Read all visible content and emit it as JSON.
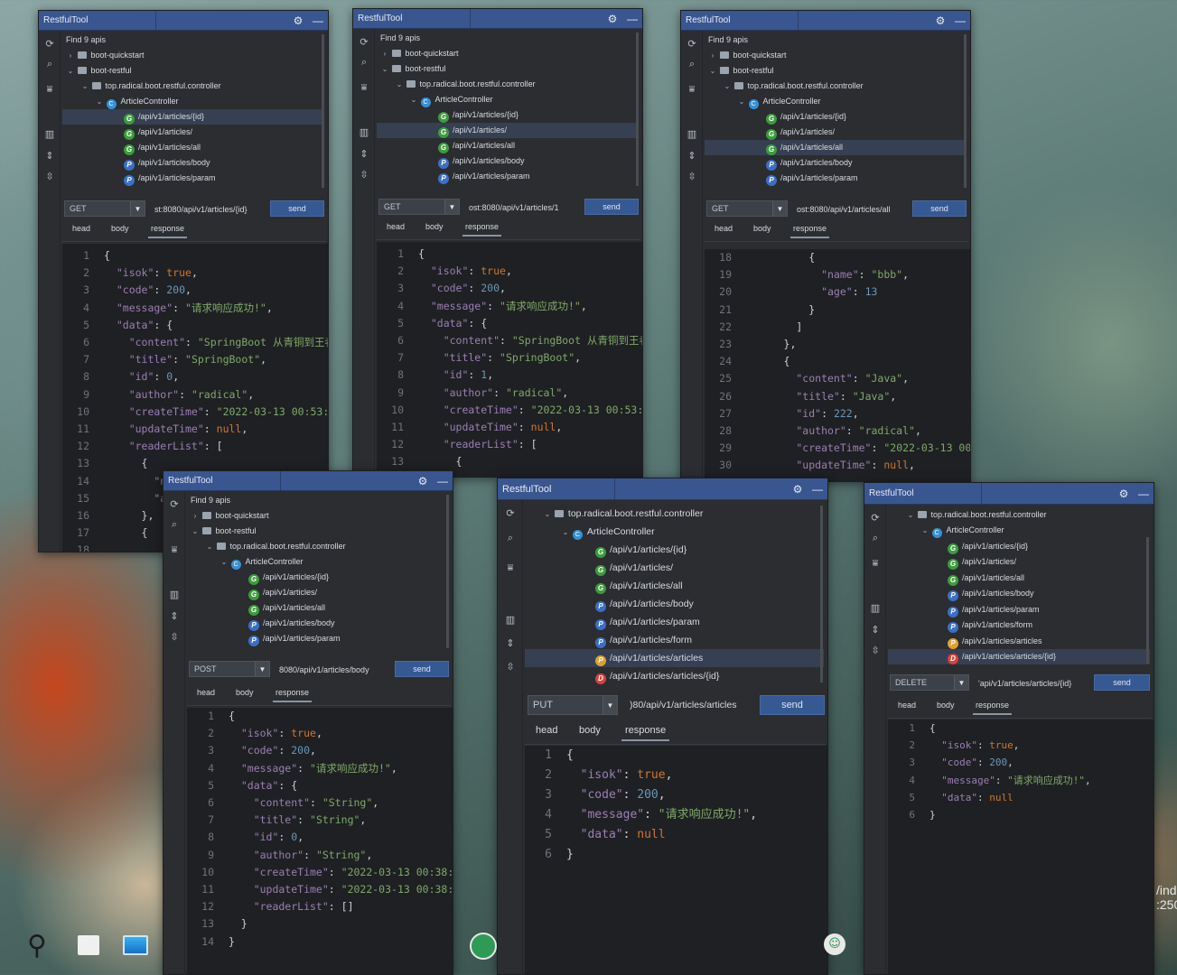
{
  "app_title": "RestfulTool",
  "find_label": "Find 9 apis",
  "tree": {
    "module_a": "boot-quickstart",
    "module_b": "boot-restful",
    "package": "top.radical.boot.restful.controller",
    "controller": "ArticleController"
  },
  "methods": {
    "get": "GET",
    "post": "POST",
    "put": "PUT",
    "delete": "DELETE"
  },
  "tabs": {
    "head": "head",
    "body": "body",
    "response": "response"
  },
  "send_label": "send",
  "windows": [
    {
      "method": "GET",
      "url": "st:8080/api/v1/articles/{id}"
    },
    {
      "method": "GET",
      "url": "ost:8080/api/v1/articles/1"
    },
    {
      "method": "GET",
      "url": "ost:8080/api/v1/articles/all"
    },
    {
      "method": "POST",
      "url": "8080/api/v1/articles/body"
    },
    {
      "method": "PUT",
      "url": ")80/api/v1/articles/articles"
    },
    {
      "method": "DELETE",
      "url": "'api/v1/articles/articles/{id}"
    }
  ],
  "api_labels": [
    "/api/v1/articles/{id}",
    "/api/v1/articles/",
    "/api/v1/articles/all",
    "/api/v1/articles/body",
    "/api/v1/articles/param",
    "/api/v1/articles/form",
    "/api/v1/articles/articles",
    "/api/v1/articles/articles/{id}"
  ],
  "badges": [
    "G",
    "G",
    "G",
    "P",
    "P",
    "P",
    "P",
    "D"
  ],
  "colors": {
    "accent": "#3a5690",
    "get": "#3c9c3c",
    "post": "#3b6fc7",
    "put": "#e0a030",
    "delete": "#d8413c",
    "string": "#7fa86a",
    "number": "#6897bb",
    "keyword": "#cc7832",
    "key": "#9b7fb5"
  },
  "taskbar": {
    "partial_text_1": "/ind",
    "partial_text_2": ":250"
  },
  "responses": {
    "w1": [
      [
        {
          "t": "{",
          "c": "p"
        }
      ],
      [
        {
          "t": "  \"isok\"",
          "c": "k"
        },
        {
          "t": ": ",
          "c": "p"
        },
        {
          "t": "true",
          "c": "b"
        },
        {
          "t": ",",
          "c": "p"
        }
      ],
      [
        {
          "t": "  \"code\"",
          "c": "k"
        },
        {
          "t": ": ",
          "c": "p"
        },
        {
          "t": "200",
          "c": "n"
        },
        {
          "t": ",",
          "c": "p"
        }
      ],
      [
        {
          "t": "  \"message\"",
          "c": "k"
        },
        {
          "t": ": ",
          "c": "p"
        },
        {
          "t": "\"请求响应成功!\"",
          "c": "s"
        },
        {
          "t": ",",
          "c": "p"
        }
      ],
      [
        {
          "t": "  \"data\"",
          "c": "k"
        },
        {
          "t": ": {",
          "c": "p"
        }
      ],
      [
        {
          "t": "    \"content\"",
          "c": "k"
        },
        {
          "t": ": ",
          "c": "p"
        },
        {
          "t": "\"SpringBoot 从青铜到王者",
          "c": "s"
        }
      ],
      [
        {
          "t": "    \"title\"",
          "c": "k"
        },
        {
          "t": ": ",
          "c": "p"
        },
        {
          "t": "\"SpringBoot\"",
          "c": "s"
        },
        {
          "t": ",",
          "c": "p"
        }
      ],
      [
        {
          "t": "    \"id\"",
          "c": "k"
        },
        {
          "t": ": ",
          "c": "p"
        },
        {
          "t": "0",
          "c": "n"
        },
        {
          "t": ",",
          "c": "p"
        }
      ],
      [
        {
          "t": "    \"author\"",
          "c": "k"
        },
        {
          "t": ": ",
          "c": "p"
        },
        {
          "t": "\"radical\"",
          "c": "s"
        },
        {
          "t": ",",
          "c": "p"
        }
      ],
      [
        {
          "t": "    \"createTime\"",
          "c": "k"
        },
        {
          "t": ": ",
          "c": "p"
        },
        {
          "t": "\"2022-03-13 00:53:0",
          "c": "s"
        }
      ],
      [
        {
          "t": "    \"updateTime\"",
          "c": "k"
        },
        {
          "t": ": ",
          "c": "p"
        },
        {
          "t": "null",
          "c": "b"
        },
        {
          "t": ",",
          "c": "p"
        }
      ],
      [
        {
          "t": "    \"readerList\"",
          "c": "k"
        },
        {
          "t": ": [",
          "c": "p"
        }
      ],
      [
        {
          "t": "      {",
          "c": "p"
        }
      ],
      [
        {
          "t": "        \"nam",
          "c": "k"
        }
      ],
      [
        {
          "t": "        \"age",
          "c": "k"
        }
      ],
      [
        {
          "t": "      },",
          "c": "p"
        }
      ],
      [
        {
          "t": "      {",
          "c": "p"
        }
      ],
      [
        {
          "t": "",
          "c": "p"
        }
      ]
    ],
    "w2": [
      [
        {
          "t": "{",
          "c": "p"
        }
      ],
      [
        {
          "t": "  \"isok\"",
          "c": "k"
        },
        {
          "t": ": ",
          "c": "p"
        },
        {
          "t": "true",
          "c": "b"
        },
        {
          "t": ",",
          "c": "p"
        }
      ],
      [
        {
          "t": "  \"code\"",
          "c": "k"
        },
        {
          "t": ": ",
          "c": "p"
        },
        {
          "t": "200",
          "c": "n"
        },
        {
          "t": ",",
          "c": "p"
        }
      ],
      [
        {
          "t": "  \"message\"",
          "c": "k"
        },
        {
          "t": ": ",
          "c": "p"
        },
        {
          "t": "\"请求响应成功!\"",
          "c": "s"
        },
        {
          "t": ",",
          "c": "p"
        }
      ],
      [
        {
          "t": "  \"data\"",
          "c": "k"
        },
        {
          "t": ": {",
          "c": "p"
        }
      ],
      [
        {
          "t": "    \"content\"",
          "c": "k"
        },
        {
          "t": ": ",
          "c": "p"
        },
        {
          "t": "\"SpringBoot 从青铜到王者",
          "c": "s"
        }
      ],
      [
        {
          "t": "    \"title\"",
          "c": "k"
        },
        {
          "t": ": ",
          "c": "p"
        },
        {
          "t": "\"SpringBoot\"",
          "c": "s"
        },
        {
          "t": ",",
          "c": "p"
        }
      ],
      [
        {
          "t": "    \"id\"",
          "c": "k"
        },
        {
          "t": ": ",
          "c": "p"
        },
        {
          "t": "1",
          "c": "n"
        },
        {
          "t": ",",
          "c": "p"
        }
      ],
      [
        {
          "t": "    \"author\"",
          "c": "k"
        },
        {
          "t": ": ",
          "c": "p"
        },
        {
          "t": "\"radical\"",
          "c": "s"
        },
        {
          "t": ",",
          "c": "p"
        }
      ],
      [
        {
          "t": "    \"createTime\"",
          "c": "k"
        },
        {
          "t": ": ",
          "c": "p"
        },
        {
          "t": "\"2022-03-13 00:53:1",
          "c": "s"
        }
      ],
      [
        {
          "t": "    \"updateTime\"",
          "c": "k"
        },
        {
          "t": ": ",
          "c": "p"
        },
        {
          "t": "null",
          "c": "b"
        },
        {
          "t": ",",
          "c": "p"
        }
      ],
      [
        {
          "t": "    \"readerList\"",
          "c": "k"
        },
        {
          "t": ": [",
          "c": "p"
        }
      ],
      [
        {
          "t": "      {",
          "c": "p"
        }
      ]
    ],
    "w3": [
      [
        {
          "t": "          {",
          "c": "p"
        }
      ],
      [
        {
          "t": "            \"name\"",
          "c": "k"
        },
        {
          "t": ": ",
          "c": "p"
        },
        {
          "t": "\"bbb\"",
          "c": "s"
        },
        {
          "t": ",",
          "c": "p"
        }
      ],
      [
        {
          "t": "            \"age\"",
          "c": "k"
        },
        {
          "t": ": ",
          "c": "p"
        },
        {
          "t": "13",
          "c": "n"
        }
      ],
      [
        {
          "t": "          }",
          "c": "p"
        }
      ],
      [
        {
          "t": "        ]",
          "c": "p"
        }
      ],
      [
        {
          "t": "      },",
          "c": "p"
        }
      ],
      [
        {
          "t": "      {",
          "c": "p"
        }
      ],
      [
        {
          "t": "        \"content\"",
          "c": "k"
        },
        {
          "t": ": ",
          "c": "p"
        },
        {
          "t": "\"Java\"",
          "c": "s"
        },
        {
          "t": ",",
          "c": "p"
        }
      ],
      [
        {
          "t": "        \"title\"",
          "c": "k"
        },
        {
          "t": ": ",
          "c": "p"
        },
        {
          "t": "\"Java\"",
          "c": "s"
        },
        {
          "t": ",",
          "c": "p"
        }
      ],
      [
        {
          "t": "        \"id\"",
          "c": "k"
        },
        {
          "t": ": ",
          "c": "p"
        },
        {
          "t": "222",
          "c": "n"
        },
        {
          "t": ",",
          "c": "p"
        }
      ],
      [
        {
          "t": "        \"author\"",
          "c": "k"
        },
        {
          "t": ": ",
          "c": "p"
        },
        {
          "t": "\"radical\"",
          "c": "s"
        },
        {
          "t": ",",
          "c": "p"
        }
      ],
      [
        {
          "t": "        \"createTime\"",
          "c": "k"
        },
        {
          "t": ": ",
          "c": "p"
        },
        {
          "t": "\"2022-03-13 00:5",
          "c": "s"
        }
      ],
      [
        {
          "t": "        \"updateTime\"",
          "c": "k"
        },
        {
          "t": ": ",
          "c": "p"
        },
        {
          "t": "null",
          "c": "b"
        },
        {
          "t": ",",
          "c": "p"
        }
      ]
    ],
    "w4": [
      [
        {
          "t": "{",
          "c": "p"
        }
      ],
      [
        {
          "t": "  \"isok\"",
          "c": "k"
        },
        {
          "t": ": ",
          "c": "p"
        },
        {
          "t": "true",
          "c": "b"
        },
        {
          "t": ",",
          "c": "p"
        }
      ],
      [
        {
          "t": "  \"code\"",
          "c": "k"
        },
        {
          "t": ": ",
          "c": "p"
        },
        {
          "t": "200",
          "c": "n"
        },
        {
          "t": ",",
          "c": "p"
        }
      ],
      [
        {
          "t": "  \"message\"",
          "c": "k"
        },
        {
          "t": ": ",
          "c": "p"
        },
        {
          "t": "\"请求响应成功!\"",
          "c": "s"
        },
        {
          "t": ",",
          "c": "p"
        }
      ],
      [
        {
          "t": "  \"data\"",
          "c": "k"
        },
        {
          "t": ": {",
          "c": "p"
        }
      ],
      [
        {
          "t": "    \"content\"",
          "c": "k"
        },
        {
          "t": ": ",
          "c": "p"
        },
        {
          "t": "\"String\"",
          "c": "s"
        },
        {
          "t": ",",
          "c": "p"
        }
      ],
      [
        {
          "t": "    \"title\"",
          "c": "k"
        },
        {
          "t": ": ",
          "c": "p"
        },
        {
          "t": "\"String\"",
          "c": "s"
        },
        {
          "t": ",",
          "c": "p"
        }
      ],
      [
        {
          "t": "    \"id\"",
          "c": "k"
        },
        {
          "t": ": ",
          "c": "p"
        },
        {
          "t": "0",
          "c": "n"
        },
        {
          "t": ",",
          "c": "p"
        }
      ],
      [
        {
          "t": "    \"author\"",
          "c": "k"
        },
        {
          "t": ": ",
          "c": "p"
        },
        {
          "t": "\"String\"",
          "c": "s"
        },
        {
          "t": ",",
          "c": "p"
        }
      ],
      [
        {
          "t": "    \"createTime\"",
          "c": "k"
        },
        {
          "t": ": ",
          "c": "p"
        },
        {
          "t": "\"2022-03-13 00:38:03",
          "c": "s"
        }
      ],
      [
        {
          "t": "    \"updateTime\"",
          "c": "k"
        },
        {
          "t": ": ",
          "c": "p"
        },
        {
          "t": "\"2022-03-13 00:38:03",
          "c": "s"
        }
      ],
      [
        {
          "t": "    \"readerList\"",
          "c": "k"
        },
        {
          "t": ": ",
          "c": "p"
        },
        {
          "t": "[]",
          "c": "p"
        }
      ],
      [
        {
          "t": "  }",
          "c": "p"
        }
      ],
      [
        {
          "t": "}",
          "c": "p"
        }
      ]
    ],
    "w5": [
      [
        {
          "t": "{",
          "c": "p"
        }
      ],
      [
        {
          "t": "  \"isok\"",
          "c": "k"
        },
        {
          "t": ": ",
          "c": "p"
        },
        {
          "t": "true",
          "c": "b"
        },
        {
          "t": ",",
          "c": "p"
        }
      ],
      [
        {
          "t": "  \"code\"",
          "c": "k"
        },
        {
          "t": ": ",
          "c": "p"
        },
        {
          "t": "200",
          "c": "n"
        },
        {
          "t": ",",
          "c": "p"
        }
      ],
      [
        {
          "t": "  \"message\"",
          "c": "k"
        },
        {
          "t": ": ",
          "c": "p"
        },
        {
          "t": "\"请求响应成功!\"",
          "c": "s"
        },
        {
          "t": ",",
          "c": "p"
        }
      ],
      [
        {
          "t": "  \"data\"",
          "c": "k"
        },
        {
          "t": ": ",
          "c": "p"
        },
        {
          "t": "null",
          "c": "b"
        }
      ],
      [
        {
          "t": "}",
          "c": "p"
        }
      ]
    ],
    "w6": [
      [
        {
          "t": "{",
          "c": "p"
        }
      ],
      [
        {
          "t": "  \"isok\"",
          "c": "k"
        },
        {
          "t": ": ",
          "c": "p"
        },
        {
          "t": "true",
          "c": "b"
        },
        {
          "t": ",",
          "c": "p"
        }
      ],
      [
        {
          "t": "  \"code\"",
          "c": "k"
        },
        {
          "t": ": ",
          "c": "p"
        },
        {
          "t": "200",
          "c": "n"
        },
        {
          "t": ",",
          "c": "p"
        }
      ],
      [
        {
          "t": "  \"message\"",
          "c": "k"
        },
        {
          "t": ": ",
          "c": "p"
        },
        {
          "t": "\"请求响应成功!\"",
          "c": "s"
        },
        {
          "t": ",",
          "c": "p"
        }
      ],
      [
        {
          "t": "  \"data\"",
          "c": "k"
        },
        {
          "t": ": ",
          "c": "p"
        },
        {
          "t": "null",
          "c": "b"
        }
      ],
      [
        {
          "t": "}",
          "c": "p"
        }
      ]
    ]
  },
  "line_start": {
    "w1": 1,
    "w2": 1,
    "w3": 18,
    "w4": 1,
    "w5": 1,
    "w6": 1
  }
}
